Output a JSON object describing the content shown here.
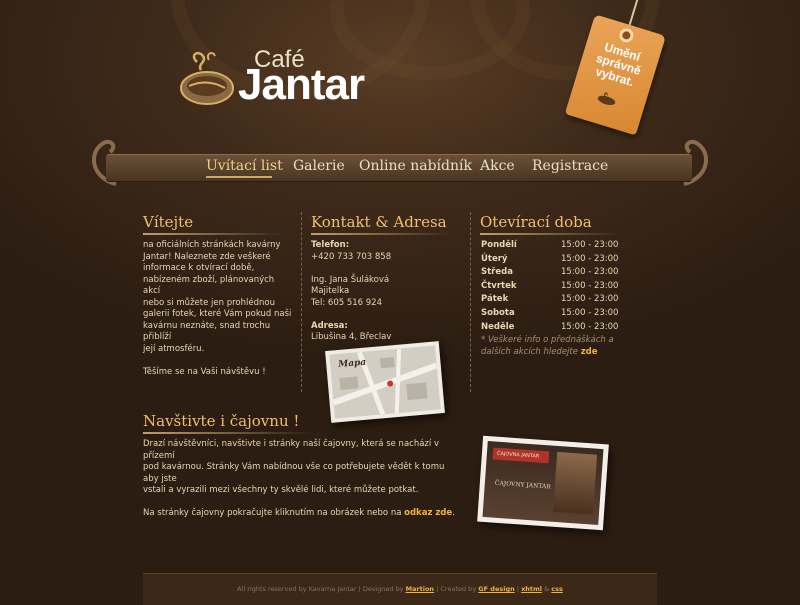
{
  "brand": {
    "small": "Café",
    "big": "Jantar"
  },
  "tag_text": [
    "Umění",
    "správně",
    "vybrat."
  ],
  "nav": [
    {
      "label": "Uvítací list",
      "active": true
    },
    {
      "label": "Galerie",
      "active": false
    },
    {
      "label": "Online nabídník",
      "active": false
    },
    {
      "label": "Akce",
      "active": false
    },
    {
      "label": "Registrace",
      "active": false
    }
  ],
  "welcome": {
    "title": "Vítejte",
    "lines": [
      "na oficiálních stránkách kavárny",
      "Jantar! Naleznete zde veškeré",
      "informace k otvírací době,",
      "nabízeném zboží, plánovaných akcí",
      "nebo si můžete jen prohlédnou",
      "galerii fotek, které Vám pokud naši",
      "kavárnu neznáte, snad trochu přiblíží",
      "její atmosféru."
    ],
    "closing": "Těšíme se na Vaši návštěvu !"
  },
  "contact": {
    "title": "Kontakt & Adresa",
    "phone_label": "Telefon:",
    "phone": "+420 733 703 858",
    "owner_name": "Ing. Jana Šuláková",
    "owner_role": "Majitelka",
    "tel": "Tel: 605 516 924",
    "address_label": "Adresa:",
    "address": "Libušina 4, Břeclav",
    "map_label": "Mapa"
  },
  "hours": {
    "title": "Otevírací doba",
    "rows": [
      {
        "day": "Pondělí",
        "time": "15:00 - 23:00"
      },
      {
        "day": "Úterý",
        "time": "15:00 - 23:00"
      },
      {
        "day": "Středa",
        "time": "15:00 - 23:00"
      },
      {
        "day": "Čtvrtek",
        "time": "15:00 - 23:00"
      },
      {
        "day": "Pátek",
        "time": "15:00 - 23:00"
      },
      {
        "day": "Sobota",
        "time": "15:00 - 23:00"
      },
      {
        "day": "Neděle",
        "time": "15:00 - 23:00"
      }
    ],
    "note_line1": "* Veškeré info o přednáškách a",
    "note_line2": "dalších akcích hledejte",
    "note_link": "zde"
  },
  "visit": {
    "title": "Navštivte i čajovnu !",
    "lines": [
      "Drazí návštěvníci, navštivte i stránky naší čajovny, která se nachází v přízemí",
      "pod kavárnou. Stránky Vám nabídnou vše co potřebujete vědět k tomu aby jste",
      "vstali a vyrazili mezi všechny ty skvělé lidi, které můžete potkat."
    ],
    "link_prefix": "Na stránky čajovny pokračujte kliknutím na obrázek nebo na",
    "link_label": "odkaz zde",
    "link_suffix": ".",
    "photo_banner": "ČAJOVNA JANTAR",
    "photo_title": "ČAJOVNY JANTAR"
  },
  "footer": {
    "text1": "All rights reserved by Kavarna Jantar | Designed by",
    "designer": "Martion",
    "text2": "| Created by",
    "creator": "GF design",
    "text3": "|",
    "xhtml": "xhtml",
    "amp": "&",
    "css": "css"
  },
  "colors": {
    "accent": "#f2bf6b",
    "link": "#f2b13c",
    "bg": "#3e2a1a",
    "tag": "#e09540"
  }
}
